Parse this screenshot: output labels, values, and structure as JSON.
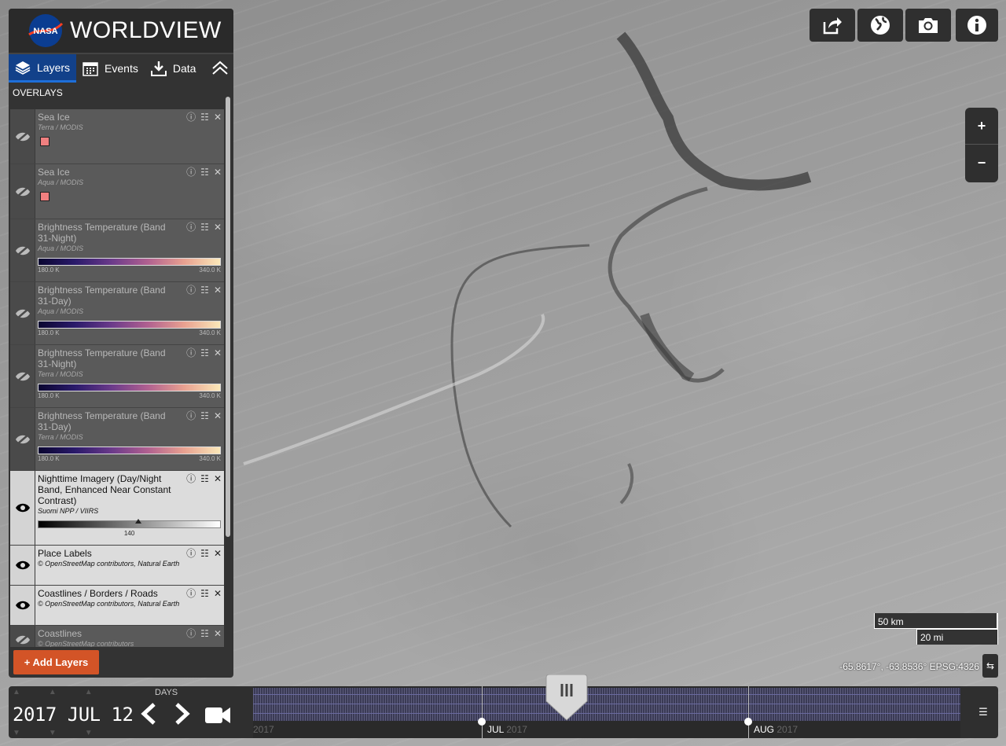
{
  "app": {
    "logo_text": "NASA",
    "title": "WORLDVIEW"
  },
  "tabs": [
    {
      "label": "Layers",
      "icon": "layers-icon"
    },
    {
      "label": "Events",
      "icon": "calendar-icon"
    },
    {
      "label": "Data",
      "icon": "download-icon"
    }
  ],
  "overlays_header": "OVERLAYS",
  "layers": [
    {
      "title": "Sea Ice",
      "source": "Terra / MODIS",
      "visible": false,
      "legend": "swatch",
      "swatch_color": "#f08080"
    },
    {
      "title": "Sea Ice",
      "source": "Aqua / MODIS",
      "visible": false,
      "legend": "swatch",
      "swatch_color": "#f08080"
    },
    {
      "title": "Brightness Temperature (Band 31-Night)",
      "source": "Aqua / MODIS",
      "visible": false,
      "legend": "colorbar",
      "min": "180.0 K",
      "max": "340.0 K"
    },
    {
      "title": "Brightness Temperature (Band 31-Day)",
      "source": "Aqua / MODIS",
      "visible": false,
      "legend": "colorbar",
      "min": "180.0 K",
      "max": "340.0 K"
    },
    {
      "title": "Brightness Temperature (Band 31-Night)",
      "source": "Terra / MODIS",
      "visible": false,
      "legend": "colorbar",
      "min": "180.0 K",
      "max": "340.0 K"
    },
    {
      "title": "Brightness Temperature (Band 31-Day)",
      "source": "Terra / MODIS",
      "visible": false,
      "legend": "colorbar",
      "min": "180.0 K",
      "max": "340.0 K"
    },
    {
      "title": "Nighttime Imagery (Day/Night Band, Enhanced Near Constant Contrast)",
      "source": "Suomi NPP / VIIRS",
      "visible": true,
      "legend": "graybar",
      "tick": "140",
      "tick_level": 0.55
    },
    {
      "title": "Place Labels",
      "source": "© OpenStreetMap contributors, Natural Earth",
      "visible": true,
      "legend": "none"
    },
    {
      "title": "Coastlines / Borders / Roads",
      "source": "© OpenStreetMap contributors, Natural Earth",
      "visible": true,
      "legend": "none"
    },
    {
      "title": "Coastlines",
      "source": "© OpenStreetMap contributors",
      "visible": false,
      "legend": "none"
    }
  ],
  "add_layers_label": "+ Add Layers",
  "toolbar": [
    {
      "name": "share-button",
      "icon": "share-icon"
    },
    {
      "name": "projection-button",
      "icon": "globe-icon"
    },
    {
      "name": "snapshot-button",
      "icon": "camera-icon"
    },
    {
      "name": "info-button",
      "icon": "info-icon"
    }
  ],
  "zoom": {
    "in_label": "+",
    "out_label": "−"
  },
  "scale": {
    "km_label": "50 km",
    "mi_label": "20 mi"
  },
  "coordinates": "-65.8617°, -63.8536° EPSG:4326",
  "timeline": {
    "zoom_level_label": "DAYS",
    "date": "2017 JUL 12",
    "months": [
      {
        "label": "2017",
        "year_only": true
      },
      {
        "label": "JUL",
        "year": "2017"
      },
      {
        "label": "AUG",
        "year": "2017"
      }
    ]
  },
  "colors": {
    "accent": "#d35427",
    "active_tab": "#12418a",
    "panel": "#333333"
  }
}
